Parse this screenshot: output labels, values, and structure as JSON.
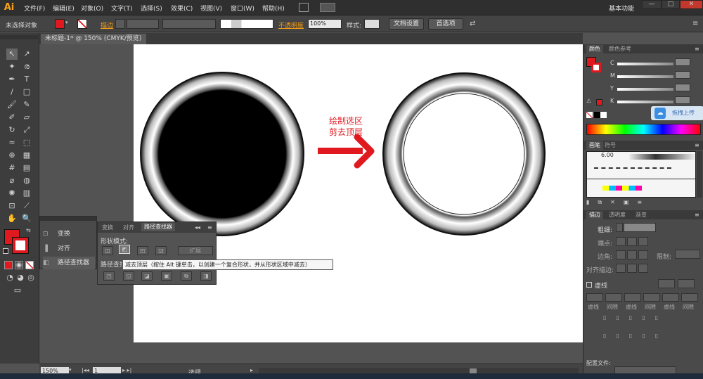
{
  "app": {
    "logo": "Ai",
    "workspace": "基本功能"
  },
  "menu": [
    "文件(F)",
    "编辑(E)",
    "对象(O)",
    "文字(T)",
    "选择(S)",
    "效果(C)",
    "视图(V)",
    "窗口(W)",
    "帮助(H)"
  ],
  "control_bar": {
    "selection": "未选择对象",
    "stroke_label": "描边",
    "opacity_label": "不透明度",
    "opacity_value": "100%",
    "style_label": "样式:",
    "doc_setup": "文档设置",
    "preferences": "首选项"
  },
  "document_tab": "未标题-1* @ 150% (CMYK/预览)",
  "canvas": {
    "annotation_line1": "绘制选区",
    "annotation_line2": "剪去顶层",
    "arrow_color": "#e0191f"
  },
  "left_panel": {
    "items": [
      "变换",
      "对齐",
      "路径查找器"
    ]
  },
  "pathfinder": {
    "tabs": [
      "变换",
      "对齐",
      "路径查找器"
    ],
    "shape_modes": "形状模式:",
    "expand": "扩展",
    "pathfinders": "路径查找器:",
    "tooltip": "减去顶层（按住 Alt 键单击，以创建一个复合形状，并从形状区域中减去）"
  },
  "color_panel": {
    "tabs": [
      "颜色",
      "颜色参考"
    ],
    "channels": [
      "C",
      "M",
      "Y",
      "K"
    ],
    "upload_badge": "拖拽上传"
  },
  "brush_panel": {
    "tabs": [
      "画笔",
      "符号"
    ],
    "size_label": "6.00"
  },
  "stroke_panel": {
    "tabs": [
      "描边",
      "透明度",
      "渐变"
    ],
    "weight_label": "粗细:",
    "cap_label": "端点:",
    "corner_label": "边角:",
    "limit_label": "限制:",
    "align_label": "对齐描边:",
    "dashed_label": "虚线",
    "dash_labels": [
      "虚线",
      "间隙",
      "虚线",
      "间隙",
      "虚线",
      "间隙"
    ],
    "profile_label": "配置文件:"
  },
  "status": {
    "zoom": "150%",
    "page": "1",
    "tool": "选择"
  }
}
